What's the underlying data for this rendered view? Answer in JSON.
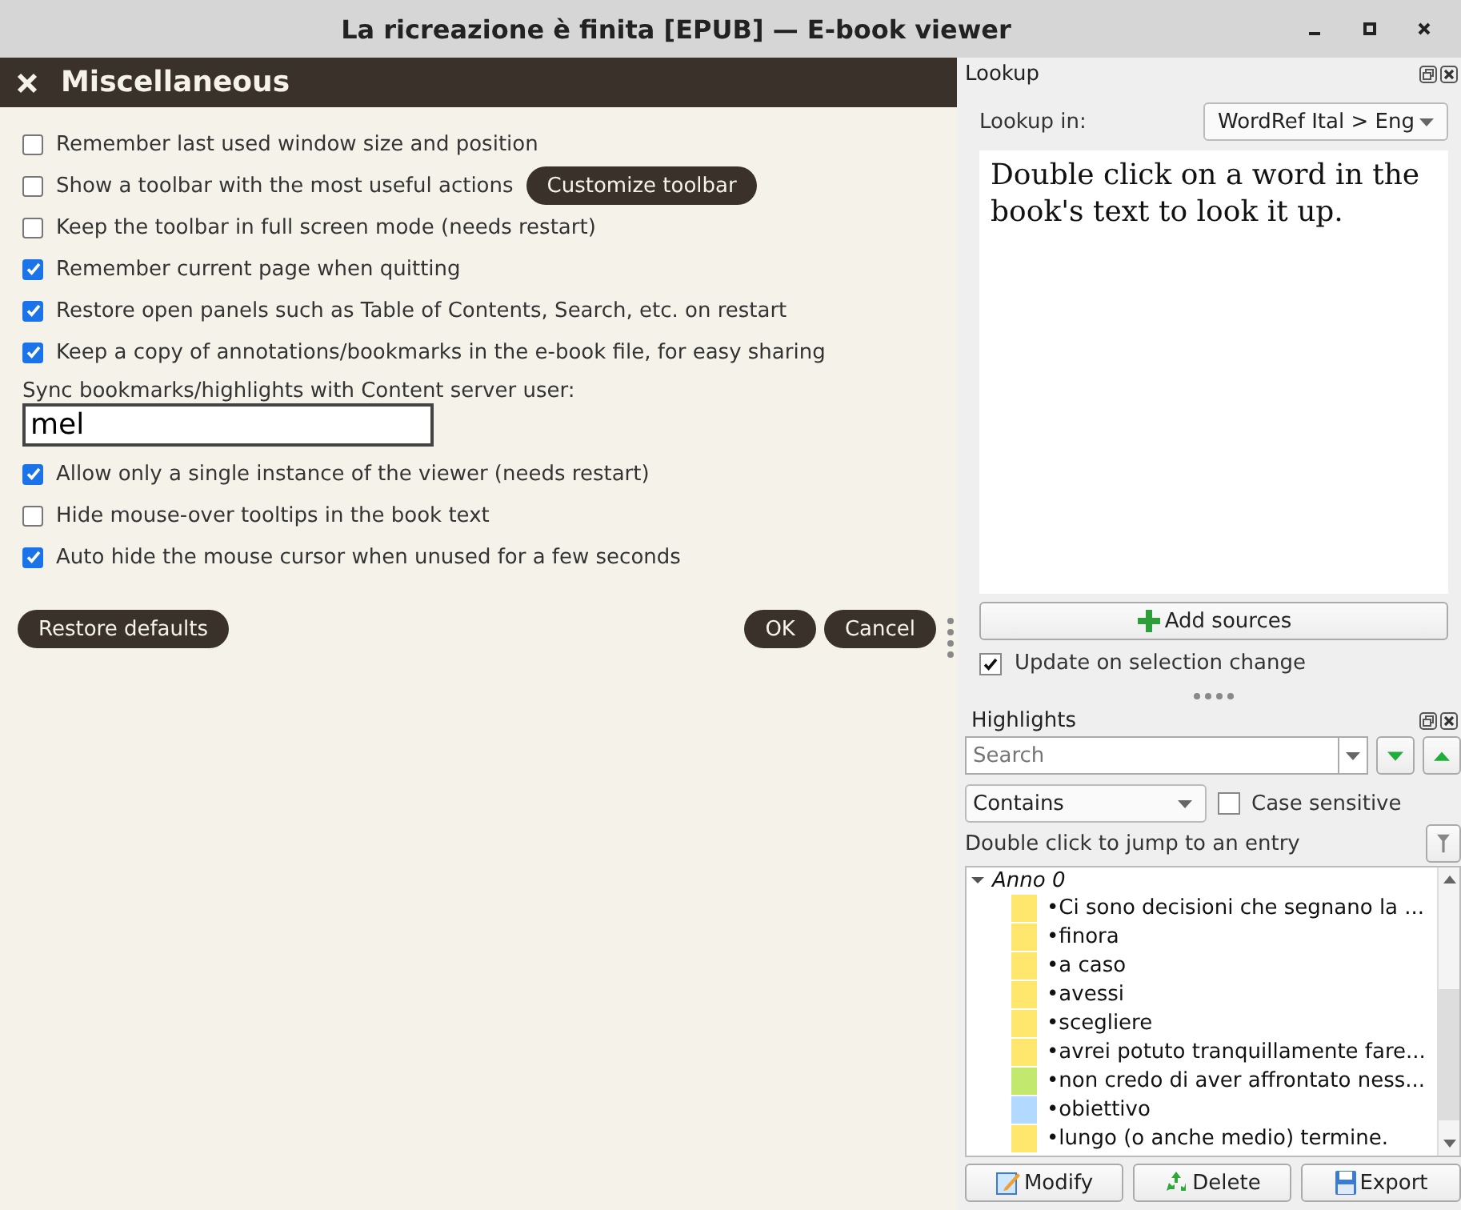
{
  "window": {
    "title": "La ricreazione è finita [EPUB] — E-book viewer"
  },
  "settings_panel": {
    "title": "Miscellaneous",
    "items": [
      {
        "kind": "checkbox",
        "label": "Remember last used window size and position",
        "checked": false
      },
      {
        "kind": "checkbox",
        "label": "Show a toolbar with the most useful actions",
        "checked": false,
        "button": "Customize toolbar"
      },
      {
        "kind": "checkbox",
        "label": "Keep the toolbar in full screen mode (needs restart)",
        "checked": false
      },
      {
        "kind": "checkbox",
        "label": "Remember current page when quitting",
        "checked": true
      },
      {
        "kind": "checkbox",
        "label": "Restore open panels such as Table of Contents, Search, etc. on restart",
        "checked": true
      },
      {
        "kind": "checkbox",
        "label": "Keep a copy of annotations/bookmarks in the e-book file, for easy sharing",
        "checked": true
      },
      {
        "kind": "field",
        "label": "Sync bookmarks/highlights with Content server user:",
        "value": "mel"
      },
      {
        "kind": "checkbox",
        "label": "Allow only a single instance of the viewer (needs restart)",
        "checked": true
      },
      {
        "kind": "checkbox",
        "label": "Hide mouse-over tooltips in the book text",
        "checked": false
      },
      {
        "kind": "checkbox",
        "label": "Auto hide the mouse cursor when unused for a few seconds",
        "checked": true
      }
    ],
    "buttons": {
      "restore": "Restore defaults",
      "ok": "OK",
      "cancel": "Cancel"
    }
  },
  "lookup": {
    "title": "Lookup",
    "source_label": "Lookup in:",
    "source": "WordRef Ital > Eng",
    "message": "Double click on a word in the book's text to look it up.",
    "add_button": "Add sources",
    "update_checkbox": {
      "label": "Update on selection change",
      "checked": true
    }
  },
  "highlights": {
    "title": "Highlights",
    "search": {
      "placeholder": "Search"
    },
    "match_mode": "Contains",
    "case_sensitive": {
      "label": "Case sensitive",
      "checked": false
    },
    "hint": "Double click to jump to an entry",
    "tree": [
      {
        "label": "Anno 0",
        "expanded": true,
        "children": [
          {
            "text": "•Ci sono decisioni che segnano la ...",
            "color": "#ffe76e"
          },
          {
            "text": "•finora",
            "color": "#ffe76e"
          },
          {
            "text": "•a caso",
            "color": "#ffe76e"
          },
          {
            "text": "•avessi",
            "color": "#ffe76e"
          },
          {
            "text": "•scegliere",
            "color": "#ffe76e"
          },
          {
            "text": "•avrei potuto tranquillamente fare...",
            "color": "#ffe76e"
          },
          {
            "text": "•non credo di aver affrontato ness...",
            "color": "#c3e86e"
          },
          {
            "text": "•obiettivo",
            "color": "#b2d9ff"
          },
          {
            "text": "•lungo (o anche medio) termine.",
            "color": "#ffe76e"
          }
        ]
      }
    ],
    "buttons": {
      "modify": "Modify",
      "delete": "Delete",
      "export": "Export"
    }
  }
}
